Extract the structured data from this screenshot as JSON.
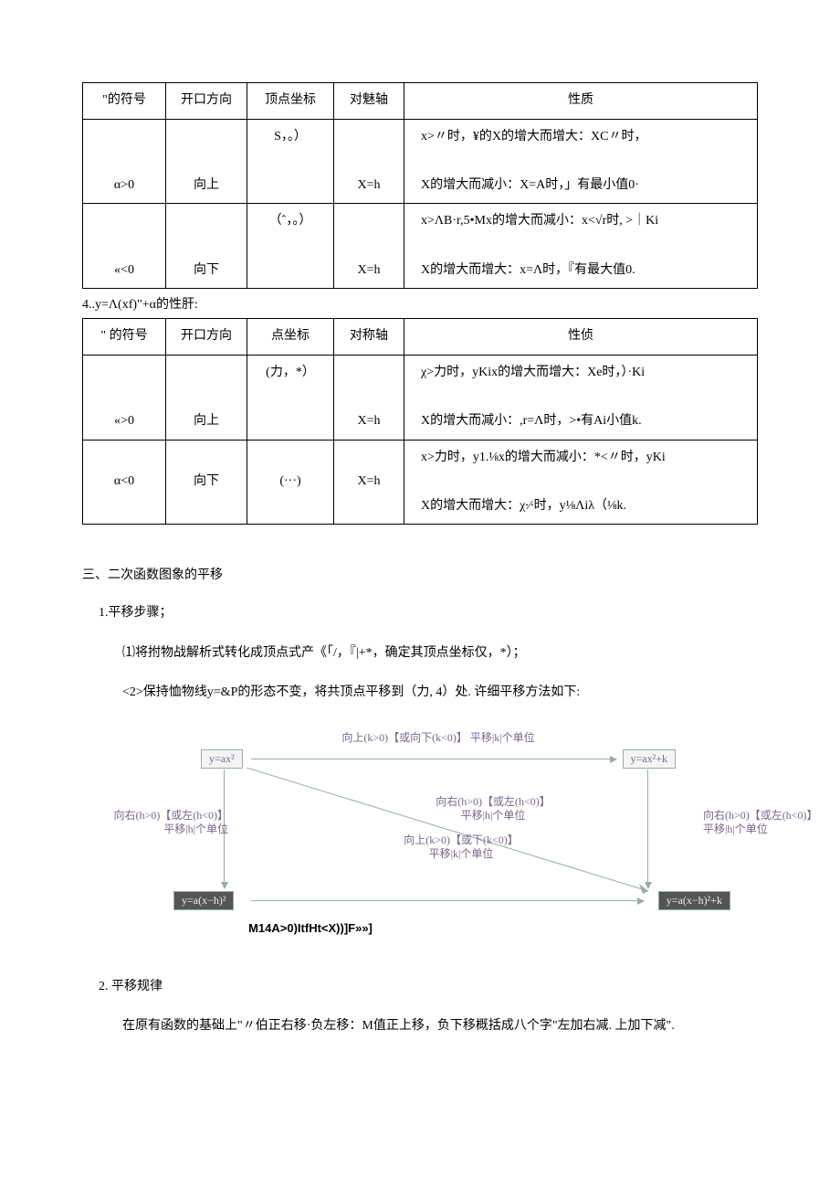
{
  "table1": {
    "headers": [
      "\"的符号",
      "开口方向",
      "顶点坐标",
      "对魅轴",
      "性质"
    ],
    "rows": [
      {
        "sign": "α>0",
        "open": "向上",
        "vertex": "S，。）",
        "axis": "X=h",
        "prop": "x>〃时，¥的X的增大而增大：XC〃时，\n\nX的增大而减小：X=A时，」有最小值0·"
      },
      {
        "sign": "«<0",
        "open": "向下",
        "vertex": "（ˆ，。）",
        "axis": "X=h",
        "prop": "x>ΛB·r,5•Mx的增大而减小：x<√r时, >｜Ki\n\nX的增大而增大：x=Λ时，『有最大值0."
      }
    ]
  },
  "midLabel": "4..y=Λ(xf)\"+α的性肝:",
  "table2": {
    "headers": [
      "\" 的符号",
      "开口方向",
      "点坐标",
      "对称轴",
      "性侦"
    ],
    "rows": [
      {
        "sign": "«>0",
        "open": "向上",
        "vertex": "(力，*）",
        "axis": "X=h",
        "prop": "χ>力时，yKix的增大而增大：Xe时，）·Ki\n\nX的增大而减小：,r=Λ时，>•有Ai小值k."
      },
      {
        "sign": "α<0",
        "open": "向下",
        "vertex": "(···)",
        "axis": "X=h",
        "prop": "x>力时，y1.⅛x的增大而减小：*<〃时，yKi\n\nX的增大而增大：χ∙⁄∙时，y⅛Λiλ（⅛k."
      }
    ]
  },
  "section3": {
    "title": "三、二次函数图象的平移",
    "h1": "1.平移步骤；",
    "p1": "⑴将拊物战解析式转化成顶点式产《「/，『|+*，确定其顶点坐标仅，*）；",
    "p2": "<2>保持恤物线y=&P的形态不变，将共顶点平移到（力, 4）处. 许细平移方法如下:"
  },
  "diagram": {
    "boxTL": "y=ax²",
    "boxTR": "y=ax²+k",
    "boxBL": "y=a(x−h)²",
    "boxBR": "y=a(x−h)²+k",
    "topArrow": "向上(k>0)【或向下(k<0)】 平移|k|个单位",
    "leftArrow": "向右(h>0)【或左(h<0)】\n平移|h|个单位",
    "rightArrow": "向右(h>0)【或左(h<0)】\n平移|h|个单位",
    "diag1": "向右(h>0)【或左(h<0)】\n平移|h|个单位",
    "diag2": "向上(k>0)【或下(k<0)】\n平移|k|个单位",
    "caption": "M14A>0)ItfHt<X))]F»»]"
  },
  "section4": {
    "h": "2. 平移规律",
    "p": "在原有函数的基础上\"〃伯正右移·负左移：M值正上移，负下移概括成八个字\"左加右减. 上加下减\"."
  }
}
